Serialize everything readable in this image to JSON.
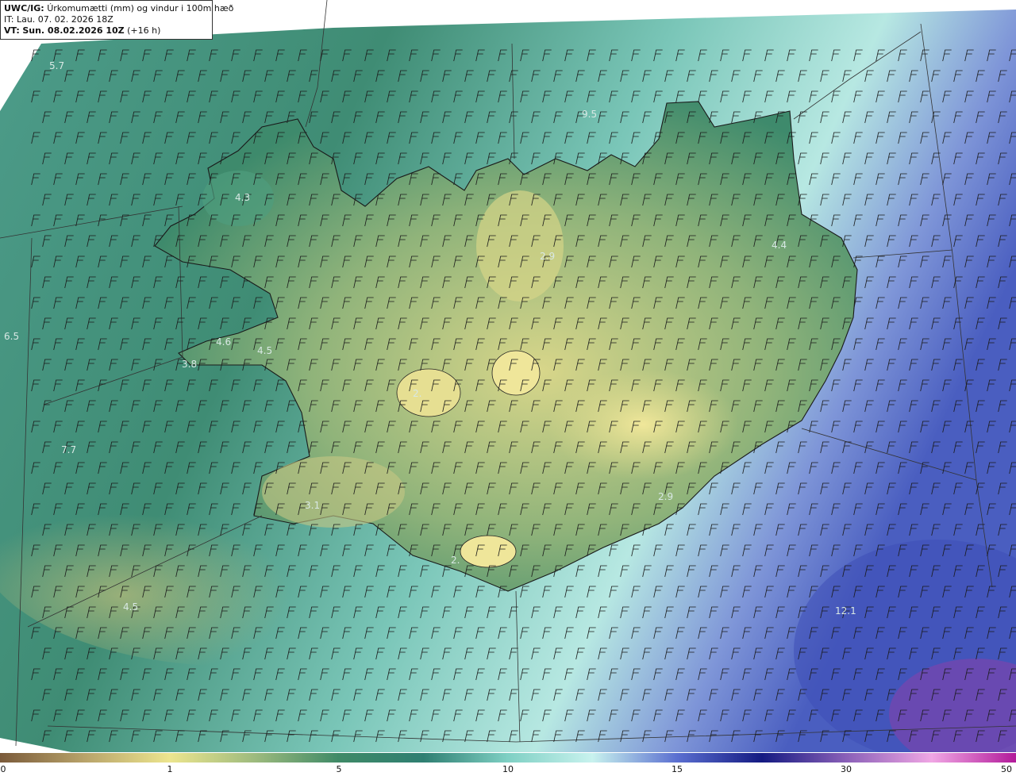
{
  "header": {
    "model_prefix": "UWC/IG:",
    "title": "Úrkomumætti (mm) og vindur i 100m hæð",
    "init_prefix": "IT:",
    "init_time": "Lau. 07. 02. 2026 18Z",
    "valid_prefix": "VT:",
    "valid_time": "Sun. 08.02.2026 10Z",
    "lead": "(+16 h)"
  },
  "value_labels": [
    {
      "text": "5.7"
    },
    {
      "text": "4.3"
    },
    {
      "text": "6.5"
    },
    {
      "text": "4.6"
    },
    {
      "text": "4.5"
    },
    {
      "text": "3.8"
    },
    {
      "text": "7.7"
    },
    {
      "text": "3.1"
    },
    {
      "text": "4.5"
    },
    {
      "text": "2.9"
    },
    {
      "text": "4.4"
    },
    {
      "text": "2.9"
    },
    {
      "text": "2."
    },
    {
      "text": "12.1"
    },
    {
      "text": "9.5"
    },
    {
      "text": "2."
    }
  ],
  "colorbar": {
    "ticks": [
      "0",
      "1",
      "5",
      "10",
      "15",
      "30",
      "50"
    ],
    "colors": [
      "#7a5a3a",
      "#b8a36a",
      "#ece58e",
      "#9ebb7e",
      "#3f8a67",
      "#2f7f72",
      "#7fd0c4",
      "#c8f2ee",
      "#5a6ed0",
      "#141a82",
      "#8a60b8",
      "#f0a6e4",
      "#b21a9a"
    ]
  },
  "field_colors": {
    "sea_low": "#2f7a60",
    "sea_mid": "#5aa89a",
    "sea_high": "#c9ece8",
    "east_blue": "#5870c8",
    "land_high": "#e5df90",
    "land_mid": "#8fb37a"
  }
}
